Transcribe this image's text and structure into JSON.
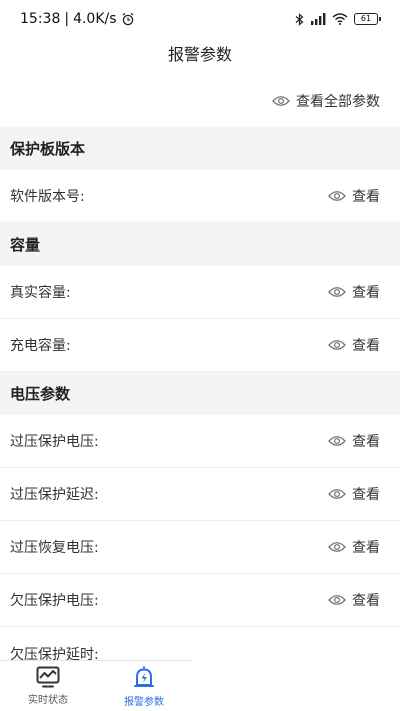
{
  "status_bar": {
    "time": "15:38",
    "net_speed": "4.0K/s",
    "battery": "61"
  },
  "header": {
    "title": "报警参数"
  },
  "view_all_label": "查看全部参数",
  "view_label": "查看",
  "sections": [
    {
      "title": "保护板版本",
      "rows": [
        {
          "label": "软件版本号:"
        }
      ]
    },
    {
      "title": "容量",
      "rows": [
        {
          "label": "真实容量:"
        },
        {
          "label": "充电容量:"
        }
      ]
    },
    {
      "title": "电压参数",
      "rows": [
        {
          "label": "过压保护电压:"
        },
        {
          "label": "过压保护延迟:"
        },
        {
          "label": "过压恢复电压:"
        },
        {
          "label": "欠压保护电压:"
        },
        {
          "label": "欠压保护延时:"
        }
      ]
    }
  ],
  "tab_bar": {
    "tabs": [
      {
        "label": "实时状态",
        "icon": "monitor-chart-icon",
        "active": false
      },
      {
        "label": "报警参数",
        "icon": "alarm-bolt-icon",
        "active": true
      }
    ],
    "accent_color": "#2f6fe0"
  }
}
